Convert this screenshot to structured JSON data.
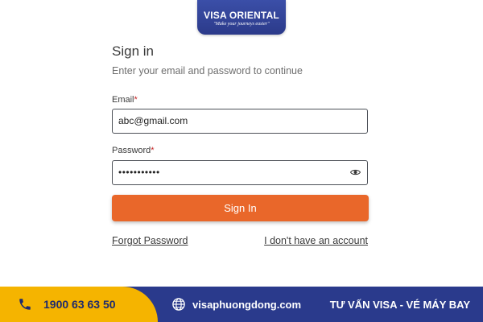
{
  "brand": {
    "logo_text": "VISA ORIENTAL",
    "tagline": "Make your journeys easier",
    "logo_color": "#2b3a8a"
  },
  "form": {
    "title": "Sign in",
    "subtitle": "Enter your email and password to continue",
    "email_label": "Email",
    "password_label": "Password",
    "required_mark": "*",
    "email_value": "abc@gmail.com",
    "password_value": "•••••••••••",
    "submit_label": "Sign In",
    "submit_color": "#e9672a",
    "forgot_link": "Forgot Password",
    "signup_link": "I don't have an account",
    "password_toggle_icon": "eye-icon"
  },
  "footer": {
    "phone": "1900 63 63 50",
    "phone_icon": "phone-icon",
    "website": "visaphuongdong.com",
    "website_icon": "globe-icon",
    "slogan": "TƯ VẤN VISA - VÉ MÁY BAY",
    "accent_color": "#f5b400",
    "background_color": "#2a3a8c"
  }
}
